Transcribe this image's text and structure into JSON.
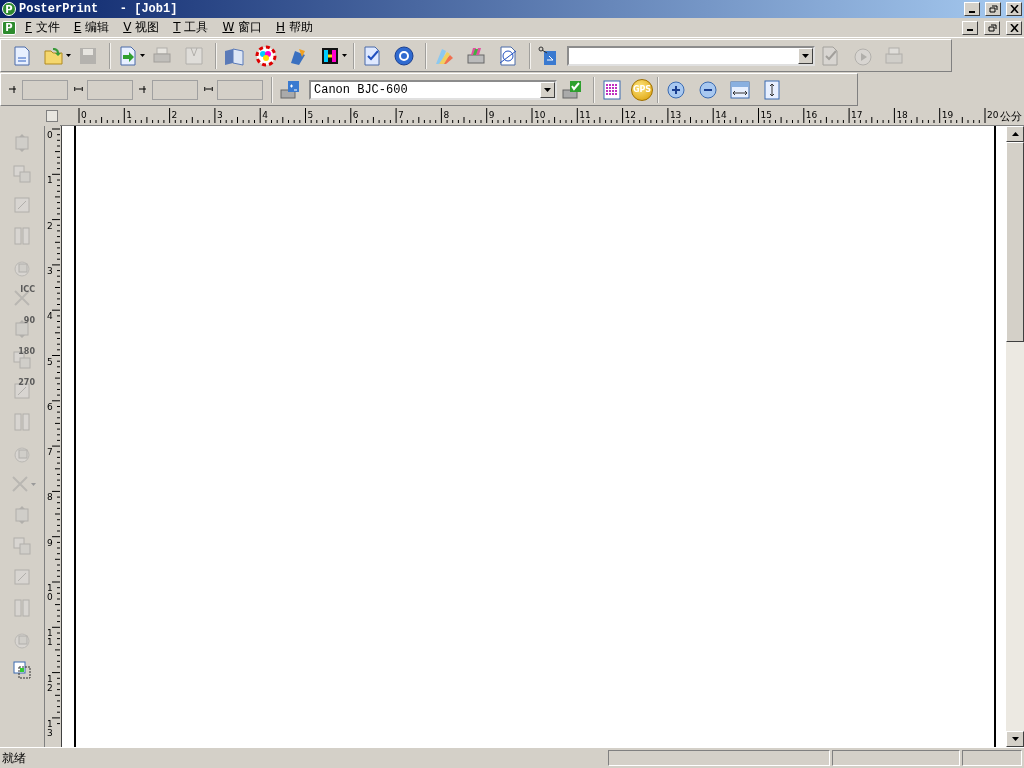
{
  "window": {
    "logo_letter": "P",
    "title": "PosterPrint   - [Job1]"
  },
  "menubar": {
    "logo_letter": "P",
    "items": [
      {
        "key": "F",
        "label": "文件"
      },
      {
        "key": "E",
        "label": "编辑"
      },
      {
        "key": "V",
        "label": "视图"
      },
      {
        "key": "T",
        "label": "工具"
      },
      {
        "key": "W",
        "label": "窗口"
      },
      {
        "key": "H",
        "label": "帮助"
      }
    ]
  },
  "toolbar_top": [
    [
      {
        "kind": "button",
        "disabled": false
      },
      {
        "kind": "split_button",
        "disabled": false
      },
      {
        "kind": "button",
        "disabled": true
      }
    ],
    [
      {
        "kind": "split_button",
        "disabled": false
      },
      {
        "kind": "button",
        "disabled": true
      },
      {
        "kind": "button",
        "disabled": true
      }
    ],
    [
      {
        "kind": "button",
        "disabled": false
      },
      {
        "kind": "button",
        "disabled": false
      },
      {
        "kind": "button",
        "disabled": false
      },
      {
        "kind": "split_button",
        "disabled": false
      }
    ],
    [
      {
        "kind": "button",
        "disabled": false
      },
      {
        "kind": "button",
        "disabled": false
      }
    ],
    [
      {
        "kind": "button",
        "disabled": false
      },
      {
        "kind": "button",
        "disabled": false
      },
      {
        "kind": "button",
        "disabled": false
      }
    ],
    [
      {
        "kind": "button",
        "disabled": false
      },
      {
        "kind": "combo"
      },
      {
        "kind": "button",
        "disabled": true
      },
      {
        "kind": "button",
        "disabled": true
      },
      {
        "kind": "button",
        "disabled": true
      }
    ]
  ],
  "toolbar_bottom": [
    [
      {
        "kind": "field"
      },
      {
        "kind": "field"
      },
      {
        "kind": "field"
      },
      {
        "kind": "field"
      }
    ],
    [
      {
        "kind": "button",
        "disabled": false
      },
      {
        "kind": "combo",
        "value": "Canon BJC-600"
      },
      {
        "kind": "button",
        "disabled": false
      }
    ],
    [
      {
        "kind": "button",
        "disabled": false
      },
      {
        "kind": "badge",
        "text": "GPS"
      }
    ],
    [
      {
        "kind": "button",
        "disabled": false
      },
      {
        "kind": "button",
        "disabled": false
      },
      {
        "kind": "button",
        "disabled": false
      },
      {
        "kind": "button",
        "disabled": false
      }
    ]
  ],
  "ruler_horizontal": {
    "labels": [
      "0",
      "1",
      "2",
      "3",
      "4",
      "5",
      "6",
      "7",
      "8",
      "9",
      "10",
      "11",
      "12",
      "13",
      "14",
      "15",
      "16",
      "17",
      "18",
      "19",
      "20"
    ],
    "unit": "公分"
  },
  "ruler_vertical": {
    "labels": [
      "0",
      "1",
      "2",
      "3",
      "4",
      "5",
      "6",
      "7",
      "8",
      "9",
      "10",
      "11",
      "12",
      "13"
    ]
  },
  "side_tools": [
    {
      "kind": "button",
      "disabled": true
    },
    {
      "kind": "button",
      "disabled": true
    },
    {
      "kind": "button",
      "disabled": true
    },
    {
      "kind": "button",
      "disabled": true
    },
    {
      "kind": "button",
      "disabled": true
    },
    {
      "kind": "button",
      "disabled": true,
      "text": "ICC"
    },
    {
      "kind": "button",
      "disabled": true,
      "text": "90"
    },
    {
      "kind": "button",
      "disabled": true,
      "text": "180"
    },
    {
      "kind": "button",
      "disabled": true,
      "text": "270"
    },
    {
      "kind": "button",
      "disabled": true
    },
    {
      "kind": "button",
      "disabled": true
    },
    {
      "kind": "split_button",
      "disabled": true
    },
    {
      "kind": "button",
      "disabled": true
    },
    {
      "kind": "button",
      "disabled": true
    },
    {
      "kind": "button",
      "disabled": true
    },
    {
      "kind": "button",
      "disabled": true
    },
    {
      "kind": "button",
      "disabled": true
    },
    {
      "kind": "button",
      "disabled": false
    }
  ],
  "status_bar": {
    "text": "就绪"
  }
}
